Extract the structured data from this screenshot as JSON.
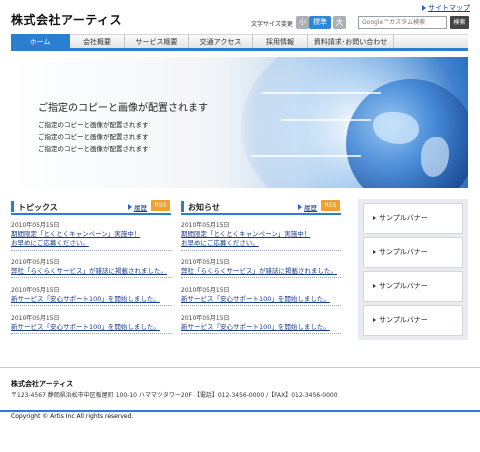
{
  "header": {
    "sitemap": "サイトマップ",
    "logo": "株式会社アーティス",
    "font_size_label": "文字サイズ変更",
    "font_small": "小",
    "font_standard": "標準",
    "font_large": "大",
    "search_placeholder": "Google™カスタム検索",
    "search_button": "検索"
  },
  "nav": [
    {
      "label": "ホーム",
      "active": true
    },
    {
      "label": "会社概要"
    },
    {
      "label": "サービス概要"
    },
    {
      "label": "交通アクセス"
    },
    {
      "label": "採用情報"
    },
    {
      "label": "資料請求･お問い合わせ"
    }
  ],
  "hero": {
    "title": "ご指定のコピーと画像が配置されます",
    "lines": [
      "ご指定のコピーと画像が配置されます",
      "ご指定のコピーと画像が配置されます",
      "ご指定のコピーと画像が配置されます"
    ]
  },
  "topics": {
    "title": "トピックス",
    "archive": "履歴",
    "rss": "RSS",
    "items": [
      {
        "date": "2010年05月15日",
        "lines": [
          "期間限定「とくとくキャンペーン」実施中！",
          "お早めにご応募ください。"
        ]
      },
      {
        "date": "2010年05月15日",
        "lines": [
          "弊社「らくらくサービス」が雑誌に掲載されました。"
        ]
      },
      {
        "date": "2010年05月15日",
        "lines": [
          "新サービス「安心サポート100」を開始しました。"
        ]
      },
      {
        "date": "2010年05月15日",
        "lines": [
          "新サービス「安心サポート100」を開始しました。"
        ]
      }
    ]
  },
  "news": {
    "title": "お知らせ",
    "archive": "履歴",
    "rss": "RSS",
    "items": [
      {
        "date": "2010年05月15日",
        "lines": [
          "期間限定「とくとくキャンペーン」実施中！",
          "お早めにご応募ください。"
        ]
      },
      {
        "date": "2010年05月15日",
        "lines": [
          "弊社「らくらくサービス」が雑誌に掲載されました。"
        ]
      },
      {
        "date": "2010年05月15日",
        "lines": [
          "新サービス「安心サポート100」を開始しました。"
        ]
      },
      {
        "date": "2010年05月15日",
        "lines": [
          "新サービス「安心サポート100」を開始しました。"
        ]
      }
    ]
  },
  "banners": [
    "サンプルバナー",
    "サンプルバナー",
    "サンプルバナー",
    "サンプルバナー"
  ],
  "footer": {
    "company": "株式会社アーティス",
    "address": "〒123-4567 静岡県浜松市中区板屋町 100-10 ハママツタワー20F 【電話】012-3456-0000 /【FAX】012-3456-0000",
    "copyright": "Copyright © Artis Inc All rights reserved."
  },
  "colors": {
    "accent": "#2b7fd3",
    "rss": "#f0a030",
    "link": "#1a3c8c"
  }
}
